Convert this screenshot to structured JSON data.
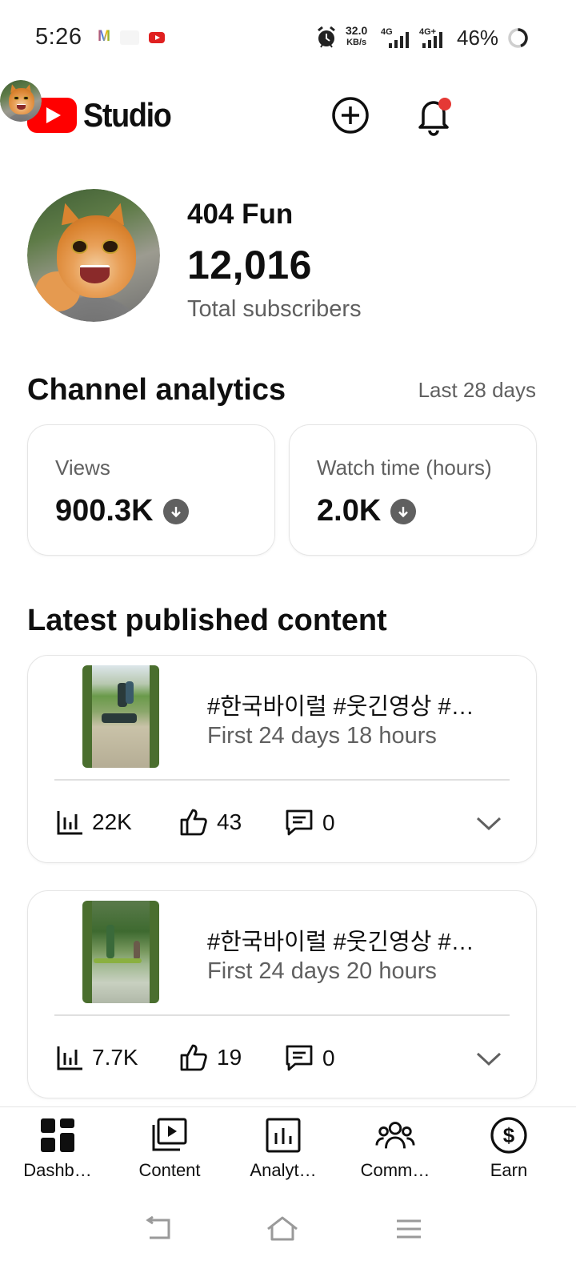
{
  "status_bar": {
    "time": "5:26",
    "network_speed": "32.0",
    "network_speed_unit": "KB/s",
    "net1": "4G",
    "net2": "4G+",
    "battery": "46%",
    "notifications": [
      "gmail-icon",
      "app-icon",
      "youtube-icon"
    ]
  },
  "header": {
    "logo_text": "Studio",
    "has_notification_dot": true
  },
  "channel": {
    "name": "404 Fun",
    "subscribers": "12,016",
    "subscribers_label": "Total subscribers"
  },
  "analytics": {
    "title": "Channel analytics",
    "range": "Last 28 days",
    "metrics": [
      {
        "label": "Views",
        "value": "900.3K",
        "trend": "down"
      },
      {
        "label": "Watch time (hours)",
        "value": "2.0K",
        "trend": "down"
      }
    ]
  },
  "latest": {
    "title": "Latest published content",
    "videos": [
      {
        "title": "#한국바이럴 #웃긴영상 #…",
        "meta": "First 24 days 18 hours",
        "views": "22K",
        "likes": "43",
        "comments": "0"
      },
      {
        "title": "#한국바이럴 #웃긴영상 #…",
        "meta": "First 24 days 20 hours",
        "views": "7.7K",
        "likes": "19",
        "comments": "0"
      }
    ]
  },
  "bottom_nav": [
    {
      "label": "Dashb…",
      "icon": "dashboard-icon",
      "active": true
    },
    {
      "label": "Content",
      "icon": "content-icon"
    },
    {
      "label": "Analyt…",
      "icon": "analytics-icon"
    },
    {
      "label": "Comm…",
      "icon": "community-icon"
    },
    {
      "label": "Earn",
      "icon": "earn-icon"
    }
  ],
  "colors": {
    "brand_red": "#ff0000",
    "notification_dot": "#e53935",
    "secondary_text": "#606060"
  }
}
